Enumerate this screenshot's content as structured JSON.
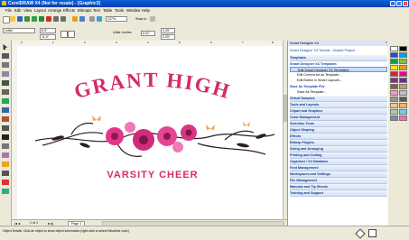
{
  "window": {
    "title": "CorelDRAW X4 (Not for resale) - [Graphic3]"
  },
  "menu": [
    "File",
    "Edit",
    "View",
    "Layout",
    "Arrange",
    "Effects",
    "Bitmaps",
    "Text",
    "Table",
    "Tools",
    "Window",
    "Help"
  ],
  "toolbar": {
    "zoom": "127%",
    "snap": "Snap to"
  },
  "propertybar": {
    "paper": "Letter",
    "width": "8.5\"",
    "height": "11.0\"",
    "units_label": "Units: inches",
    "nudge": "0.01\"",
    "dup_x": "0.25\"",
    "dup_y": "0.25\""
  },
  "ruler": {
    "units": "inches",
    "ticks": [
      "0",
      "1",
      "2",
      "3",
      "4",
      "5",
      "6",
      "7",
      "8"
    ]
  },
  "design": {
    "title": "GRANT HIGH",
    "subtitle": "VARSITY CHEER"
  },
  "page_nav": {
    "position": "1 of 1",
    "tab": "Page 1"
  },
  "docker": {
    "title": "Smart Designer X4",
    "items": [
      {
        "label": "Smart Designer X4 Tutorial - Guided Project",
        "type": "link"
      },
      {
        "label": "Templates",
        "type": "section"
      },
      {
        "label": "Smart Designer X4 Templates",
        "type": "title"
      },
      {
        "label": "Edit Smart Designer X4 Templates...",
        "type": "sub",
        "selected": true
      },
      {
        "label": "Edit Current Art as Template...",
        "type": "sub"
      },
      {
        "label": "Edit Button in Smart Layouts...",
        "type": "sub"
      },
      {
        "label": "Save As Template File",
        "type": "title"
      },
      {
        "label": "Save As Template...",
        "type": "sub"
      },
      {
        "label": "Virtual Samples",
        "type": "section"
      },
      {
        "label": "Tools and Layouts",
        "type": "section"
      },
      {
        "label": "Clipart and Graphics",
        "type": "section"
      },
      {
        "label": "Color Management",
        "type": "section"
      },
      {
        "label": "Selection Tools",
        "type": "section"
      },
      {
        "label": "Object Shaping",
        "type": "section"
      },
      {
        "label": "Effects",
        "type": "section"
      },
      {
        "label": "Bitmap Plugins",
        "type": "section"
      },
      {
        "label": "Sizing and Arranging",
        "type": "section"
      },
      {
        "label": "Printing and Cutting",
        "type": "section"
      },
      {
        "label": "Organizer / X4 Database",
        "type": "section"
      },
      {
        "label": "Font Management",
        "type": "section"
      },
      {
        "label": "Workspaces and Settings",
        "type": "section"
      },
      {
        "label": "File Management",
        "type": "section"
      },
      {
        "label": "Manuals and Tip Sheets",
        "type": "section"
      },
      {
        "label": "Training and Support",
        "type": "section"
      }
    ]
  },
  "status": {
    "text": "Object Details: Click an object to show object information (right-click to select fill/outline color)"
  },
  "colors": {
    "palette": [
      "#ffffff",
      "#000000",
      "#1e4fcf",
      "#00a0e8",
      "#00a651",
      "#7fc241",
      "#fff200",
      "#f7941d",
      "#ed1c24",
      "#ec008c",
      "#92278f",
      "#662d91",
      "#8b5e3c",
      "#c69c6d",
      "#f49ac2",
      "#bcbec0",
      "#939598",
      "#58595b",
      "#fdc689",
      "#fbaf5d",
      "#a3d39c",
      "#6dcff6",
      "#8781bd",
      "#f06eaa"
    ],
    "accent": "#d42a6b"
  }
}
